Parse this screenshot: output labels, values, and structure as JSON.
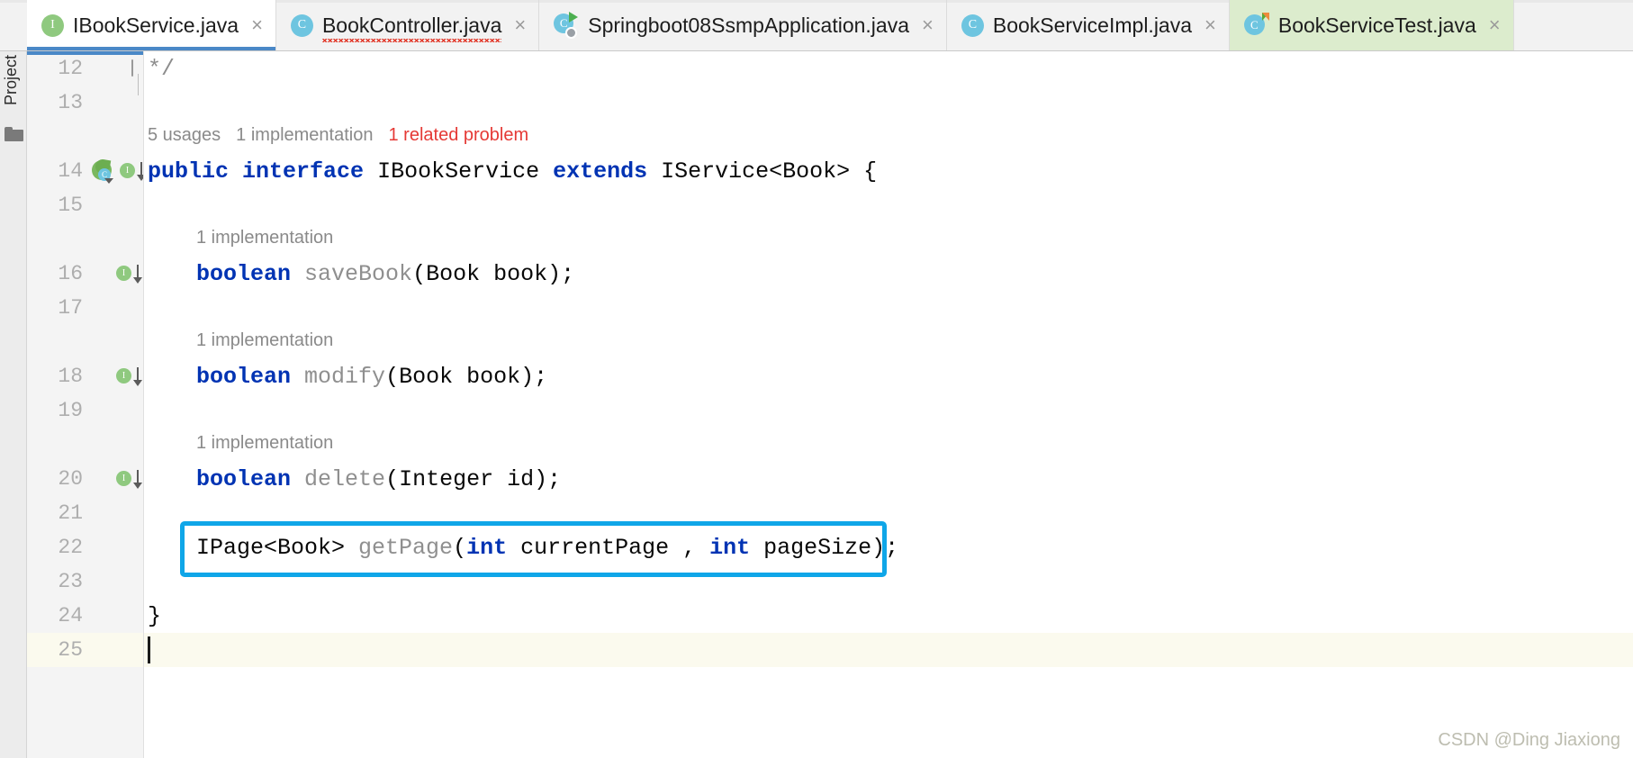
{
  "toolwindow": {
    "project_label": "Project",
    "folder_icon": "folder-icon"
  },
  "tabs": [
    {
      "label": "IBookService.java",
      "icon": "interface-icon",
      "icon_letter": "I",
      "icon_kind": "iface",
      "state": "selected",
      "close": "×",
      "squiggly": false
    },
    {
      "label": "BookController.java",
      "icon": "class-icon",
      "icon_letter": "C",
      "icon_kind": "cls",
      "state": "normal",
      "close": "×",
      "squiggly": true
    },
    {
      "label": "Springboot08SsmpApplication.java",
      "icon": "springboot-application-icon",
      "icon_letter": "C",
      "icon_kind": "boot",
      "state": "normal",
      "close": "×",
      "squiggly": false
    },
    {
      "label": "BookServiceImpl.java",
      "icon": "class-icon",
      "icon_letter": "C",
      "icon_kind": "cls",
      "state": "normal",
      "close": "×",
      "squiggly": false
    },
    {
      "label": "BookServiceTest.java",
      "icon": "test-class-icon",
      "icon_letter": "C",
      "icon_kind": "test",
      "state": "active-run",
      "close": "×",
      "squiggly": false
    }
  ],
  "gutter": {
    "lines": [
      {
        "num": "12",
        "icons": [
          "fold-minus-icon"
        ]
      },
      {
        "num": "13",
        "icons": []
      },
      {
        "num": "14",
        "icons": [
          "spring-bean-icon",
          "implemented-by-icon"
        ]
      },
      {
        "num": "15",
        "icons": []
      },
      {
        "num": "16",
        "icons": [
          "implemented-by-icon"
        ]
      },
      {
        "num": "17",
        "icons": []
      },
      {
        "num": "18",
        "icons": [
          "implemented-by-icon"
        ]
      },
      {
        "num": "19",
        "icons": []
      },
      {
        "num": "20",
        "icons": [
          "implemented-by-icon"
        ]
      },
      {
        "num": "21",
        "icons": []
      },
      {
        "num": "22",
        "icons": []
      },
      {
        "num": "23",
        "icons": []
      },
      {
        "num": "24",
        "icons": []
      },
      {
        "num": "25",
        "icons": [],
        "current": true
      }
    ]
  },
  "editor": {
    "inlay_interface": {
      "usages": "5 usages",
      "implementations": "1 implementation",
      "problem": "1 related problem"
    },
    "inlay_method": "1 implementation",
    "code": {
      "l12": "*/",
      "l14_a": "public",
      "l14_b": " ",
      "l14_c": "interface",
      "l14_d": " IBookService ",
      "l14_e": "extends",
      "l14_f": " IService<Book> {",
      "l16_type": "boolean",
      "l16_name": " saveBook",
      "l16_rest": "(Book book);",
      "l18_type": "boolean",
      "l18_name": " modify",
      "l18_rest": "(Book book);",
      "l20_type": "boolean",
      "l20_name": " delete",
      "l20_rest": "(Integer id);",
      "l22_ret": "IPage<Book>",
      "l22_name": " getPage",
      "l22_p1o": "(",
      "l22_t1": "int",
      "l22_a1": " currentPage , ",
      "l22_t2": "int",
      "l22_a2": " pageSize);",
      "l24": "}"
    }
  },
  "highlight": {
    "color": "#0fa6e8",
    "target": "getPage-method-declaration"
  },
  "watermark": "CSDN @Ding Jiaxiong"
}
